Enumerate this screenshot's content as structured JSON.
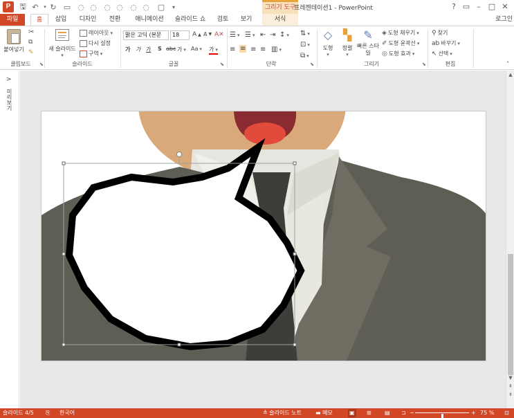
{
  "window": {
    "title": "프레젠테이션1 - PowerPoint",
    "context_tab_header": "그리기 도구",
    "help": "?",
    "login": "로그인",
    "app_logo": "P"
  },
  "tabs": [
    "파일",
    "홈",
    "삽입",
    "디자인",
    "전환",
    "애니메이션",
    "슬라이드 쇼",
    "검토",
    "보기",
    "서식"
  ],
  "ribbon": {
    "clipboard": {
      "paste": "붙여넣기",
      "label": "클립보드"
    },
    "slides": {
      "new_slide": "새 슬라이드",
      "layout": "레이아웃",
      "reset": "다시 설정",
      "section": "구역",
      "label": "슬라이드"
    },
    "font": {
      "face": "맑은 고딕 (본문",
      "size": "18",
      "bold": "가",
      "italic": "가",
      "underline": "가",
      "strike": "S",
      "spacing": "가",
      "case": "Aa",
      "color": "가",
      "label": "글꼴"
    },
    "paragraph": {
      "label": "단락"
    },
    "drawing": {
      "shapes": "도형",
      "arrange": "정렬",
      "quick_styles": "빠른 스타일",
      "fill": "도형 채우기",
      "outline": "도형 윤곽선",
      "effects": "도형 효과",
      "label": "그리기"
    },
    "editing": {
      "find": "찾기",
      "replace": "바꾸기",
      "select": "선택",
      "label": "편집"
    }
  },
  "left_pane": {
    "label": "미리보기"
  },
  "status": {
    "slide": "슬라이드 4/5",
    "language": "한국어",
    "notes": "슬라이드 노트",
    "comments": "메모",
    "zoom": "75 %",
    "zoom_fraction": 0.5
  },
  "colors": {
    "accent": "#d24726",
    "suit": "#5f5e55",
    "suit_light": "#6f6d62",
    "shirt": "#e8e7e0",
    "tie": "#3d3d3a",
    "skin": "#d9a97a",
    "mouth": "#8a2b32",
    "tongue": "#e24a3b"
  }
}
